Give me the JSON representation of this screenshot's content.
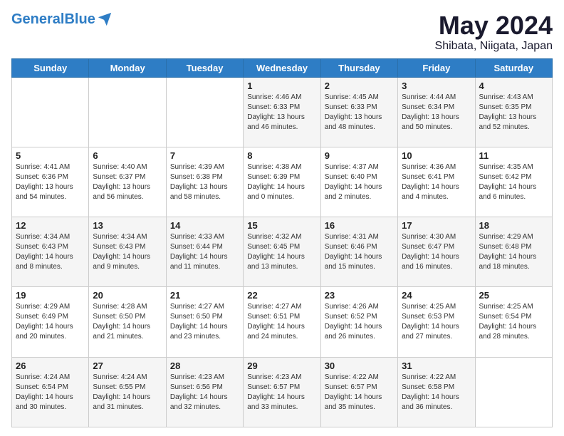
{
  "header": {
    "logo_general": "General",
    "logo_blue": "Blue",
    "month": "May 2024",
    "location": "Shibata, Niigata, Japan"
  },
  "days_of_week": [
    "Sunday",
    "Monday",
    "Tuesday",
    "Wednesday",
    "Thursday",
    "Friday",
    "Saturday"
  ],
  "weeks": [
    [
      {
        "day": "",
        "info": ""
      },
      {
        "day": "",
        "info": ""
      },
      {
        "day": "",
        "info": ""
      },
      {
        "day": "1",
        "info": "Sunrise: 4:46 AM\nSunset: 6:33 PM\nDaylight: 13 hours\nand 46 minutes."
      },
      {
        "day": "2",
        "info": "Sunrise: 4:45 AM\nSunset: 6:33 PM\nDaylight: 13 hours\nand 48 minutes."
      },
      {
        "day": "3",
        "info": "Sunrise: 4:44 AM\nSunset: 6:34 PM\nDaylight: 13 hours\nand 50 minutes."
      },
      {
        "day": "4",
        "info": "Sunrise: 4:43 AM\nSunset: 6:35 PM\nDaylight: 13 hours\nand 52 minutes."
      }
    ],
    [
      {
        "day": "5",
        "info": "Sunrise: 4:41 AM\nSunset: 6:36 PM\nDaylight: 13 hours\nand 54 minutes."
      },
      {
        "day": "6",
        "info": "Sunrise: 4:40 AM\nSunset: 6:37 PM\nDaylight: 13 hours\nand 56 minutes."
      },
      {
        "day": "7",
        "info": "Sunrise: 4:39 AM\nSunset: 6:38 PM\nDaylight: 13 hours\nand 58 minutes."
      },
      {
        "day": "8",
        "info": "Sunrise: 4:38 AM\nSunset: 6:39 PM\nDaylight: 14 hours\nand 0 minutes."
      },
      {
        "day": "9",
        "info": "Sunrise: 4:37 AM\nSunset: 6:40 PM\nDaylight: 14 hours\nand 2 minutes."
      },
      {
        "day": "10",
        "info": "Sunrise: 4:36 AM\nSunset: 6:41 PM\nDaylight: 14 hours\nand 4 minutes."
      },
      {
        "day": "11",
        "info": "Sunrise: 4:35 AM\nSunset: 6:42 PM\nDaylight: 14 hours\nand 6 minutes."
      }
    ],
    [
      {
        "day": "12",
        "info": "Sunrise: 4:34 AM\nSunset: 6:43 PM\nDaylight: 14 hours\nand 8 minutes."
      },
      {
        "day": "13",
        "info": "Sunrise: 4:34 AM\nSunset: 6:43 PM\nDaylight: 14 hours\nand 9 minutes."
      },
      {
        "day": "14",
        "info": "Sunrise: 4:33 AM\nSunset: 6:44 PM\nDaylight: 14 hours\nand 11 minutes."
      },
      {
        "day": "15",
        "info": "Sunrise: 4:32 AM\nSunset: 6:45 PM\nDaylight: 14 hours\nand 13 minutes."
      },
      {
        "day": "16",
        "info": "Sunrise: 4:31 AM\nSunset: 6:46 PM\nDaylight: 14 hours\nand 15 minutes."
      },
      {
        "day": "17",
        "info": "Sunrise: 4:30 AM\nSunset: 6:47 PM\nDaylight: 14 hours\nand 16 minutes."
      },
      {
        "day": "18",
        "info": "Sunrise: 4:29 AM\nSunset: 6:48 PM\nDaylight: 14 hours\nand 18 minutes."
      }
    ],
    [
      {
        "day": "19",
        "info": "Sunrise: 4:29 AM\nSunset: 6:49 PM\nDaylight: 14 hours\nand 20 minutes."
      },
      {
        "day": "20",
        "info": "Sunrise: 4:28 AM\nSunset: 6:50 PM\nDaylight: 14 hours\nand 21 minutes."
      },
      {
        "day": "21",
        "info": "Sunrise: 4:27 AM\nSunset: 6:50 PM\nDaylight: 14 hours\nand 23 minutes."
      },
      {
        "day": "22",
        "info": "Sunrise: 4:27 AM\nSunset: 6:51 PM\nDaylight: 14 hours\nand 24 minutes."
      },
      {
        "day": "23",
        "info": "Sunrise: 4:26 AM\nSunset: 6:52 PM\nDaylight: 14 hours\nand 26 minutes."
      },
      {
        "day": "24",
        "info": "Sunrise: 4:25 AM\nSunset: 6:53 PM\nDaylight: 14 hours\nand 27 minutes."
      },
      {
        "day": "25",
        "info": "Sunrise: 4:25 AM\nSunset: 6:54 PM\nDaylight: 14 hours\nand 28 minutes."
      }
    ],
    [
      {
        "day": "26",
        "info": "Sunrise: 4:24 AM\nSunset: 6:54 PM\nDaylight: 14 hours\nand 30 minutes."
      },
      {
        "day": "27",
        "info": "Sunrise: 4:24 AM\nSunset: 6:55 PM\nDaylight: 14 hours\nand 31 minutes."
      },
      {
        "day": "28",
        "info": "Sunrise: 4:23 AM\nSunset: 6:56 PM\nDaylight: 14 hours\nand 32 minutes."
      },
      {
        "day": "29",
        "info": "Sunrise: 4:23 AM\nSunset: 6:57 PM\nDaylight: 14 hours\nand 33 minutes."
      },
      {
        "day": "30",
        "info": "Sunrise: 4:22 AM\nSunset: 6:57 PM\nDaylight: 14 hours\nand 35 minutes."
      },
      {
        "day": "31",
        "info": "Sunrise: 4:22 AM\nSunset: 6:58 PM\nDaylight: 14 hours\nand 36 minutes."
      },
      {
        "day": "",
        "info": ""
      }
    ]
  ]
}
